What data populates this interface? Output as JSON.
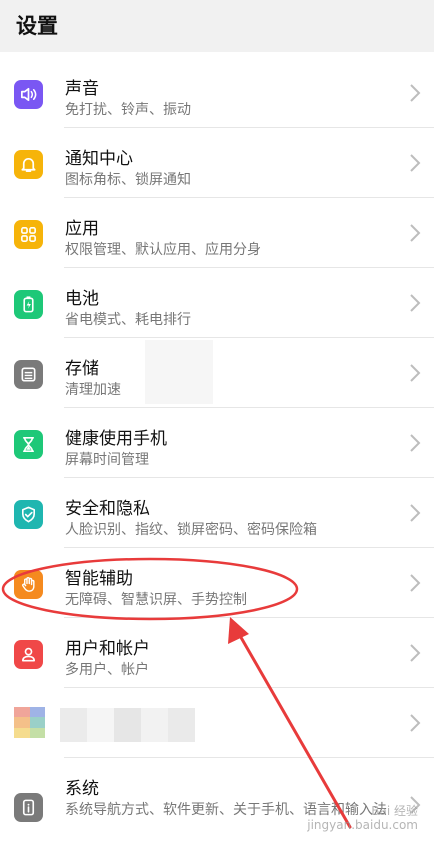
{
  "header": {
    "title": "设置"
  },
  "items": [
    {
      "id": "sound",
      "label": "声音",
      "sub": "免打扰、铃声、振动",
      "icon": "speaker-icon",
      "color": "#7a57f3"
    },
    {
      "id": "notifications",
      "label": "通知中心",
      "sub": "图标角标、锁屏通知",
      "icon": "bell-icon",
      "color": "#f6b40a"
    },
    {
      "id": "apps",
      "label": "应用",
      "sub": "权限管理、默认应用、应用分身",
      "icon": "apps-grid-icon",
      "color": "#f6b40a"
    },
    {
      "id": "battery",
      "label": "电池",
      "sub": "省电模式、耗电排行",
      "icon": "battery-icon",
      "color": "#1ec878"
    },
    {
      "id": "storage",
      "label": "存储",
      "sub": "清理加速",
      "icon": "storage-icon",
      "color": "#7a7a7a"
    },
    {
      "id": "health",
      "label": "健康使用手机",
      "sub": "屏幕时间管理",
      "icon": "hourglass-icon",
      "color": "#1ec878"
    },
    {
      "id": "security",
      "label": "安全和隐私",
      "sub": "人脸识别、指纹、锁屏密码、密码保险箱",
      "icon": "shield-icon",
      "color": "#1fb6b0"
    },
    {
      "id": "assist",
      "label": "智能辅助",
      "sub": "无障碍、智慧识屏、手势控制",
      "icon": "hand-icon",
      "color": "#f58a1f"
    },
    {
      "id": "accounts",
      "label": "用户和帐户",
      "sub": "多用户、帐户",
      "icon": "user-icon",
      "color": "#f04848"
    },
    {
      "id": "blurred",
      "label": "",
      "sub": "",
      "icon": "blurred-avatar-icon",
      "color": "#cccccc"
    },
    {
      "id": "system",
      "label": "系统",
      "sub": "系统导航方式、软件更新、关于手机、语言和输入法",
      "icon": "info-phone-icon",
      "color": "#7a7a7a"
    }
  ],
  "annotation_color": "#e83b3b",
  "watermark": {
    "line1": "Bai 经验",
    "line2": "jingyan.baidu.com"
  }
}
